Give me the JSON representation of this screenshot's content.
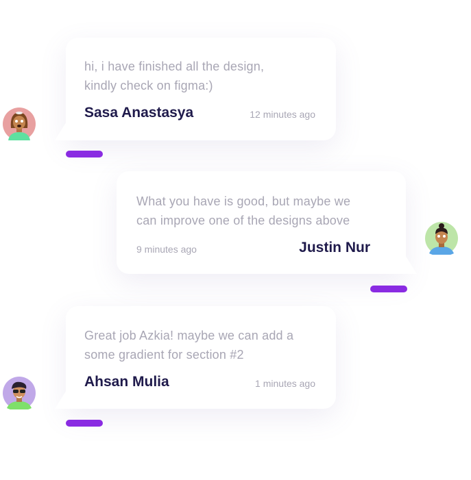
{
  "messages": [
    {
      "text_line1": "hi, i have finished all the design,",
      "text_line2": "kindly check on figma:)",
      "author": "Sasa Anastasya",
      "time": "12 minutes ago"
    },
    {
      "text_line1": "What you have is good, but maybe we",
      "text_line2": "can improve one of the designs above",
      "author": "Justin Nur",
      "time": "9 minutes ago"
    },
    {
      "text_line1": "Great job Azkia! maybe we can add a",
      "text_line2": "some gradient for section #2",
      "author": "Ahsan Mulia",
      "time": "1 minutes ago"
    }
  ],
  "colors": {
    "accent": "#8a2be2",
    "name": "#1f1a4b",
    "muted": "#a8a6b4"
  }
}
